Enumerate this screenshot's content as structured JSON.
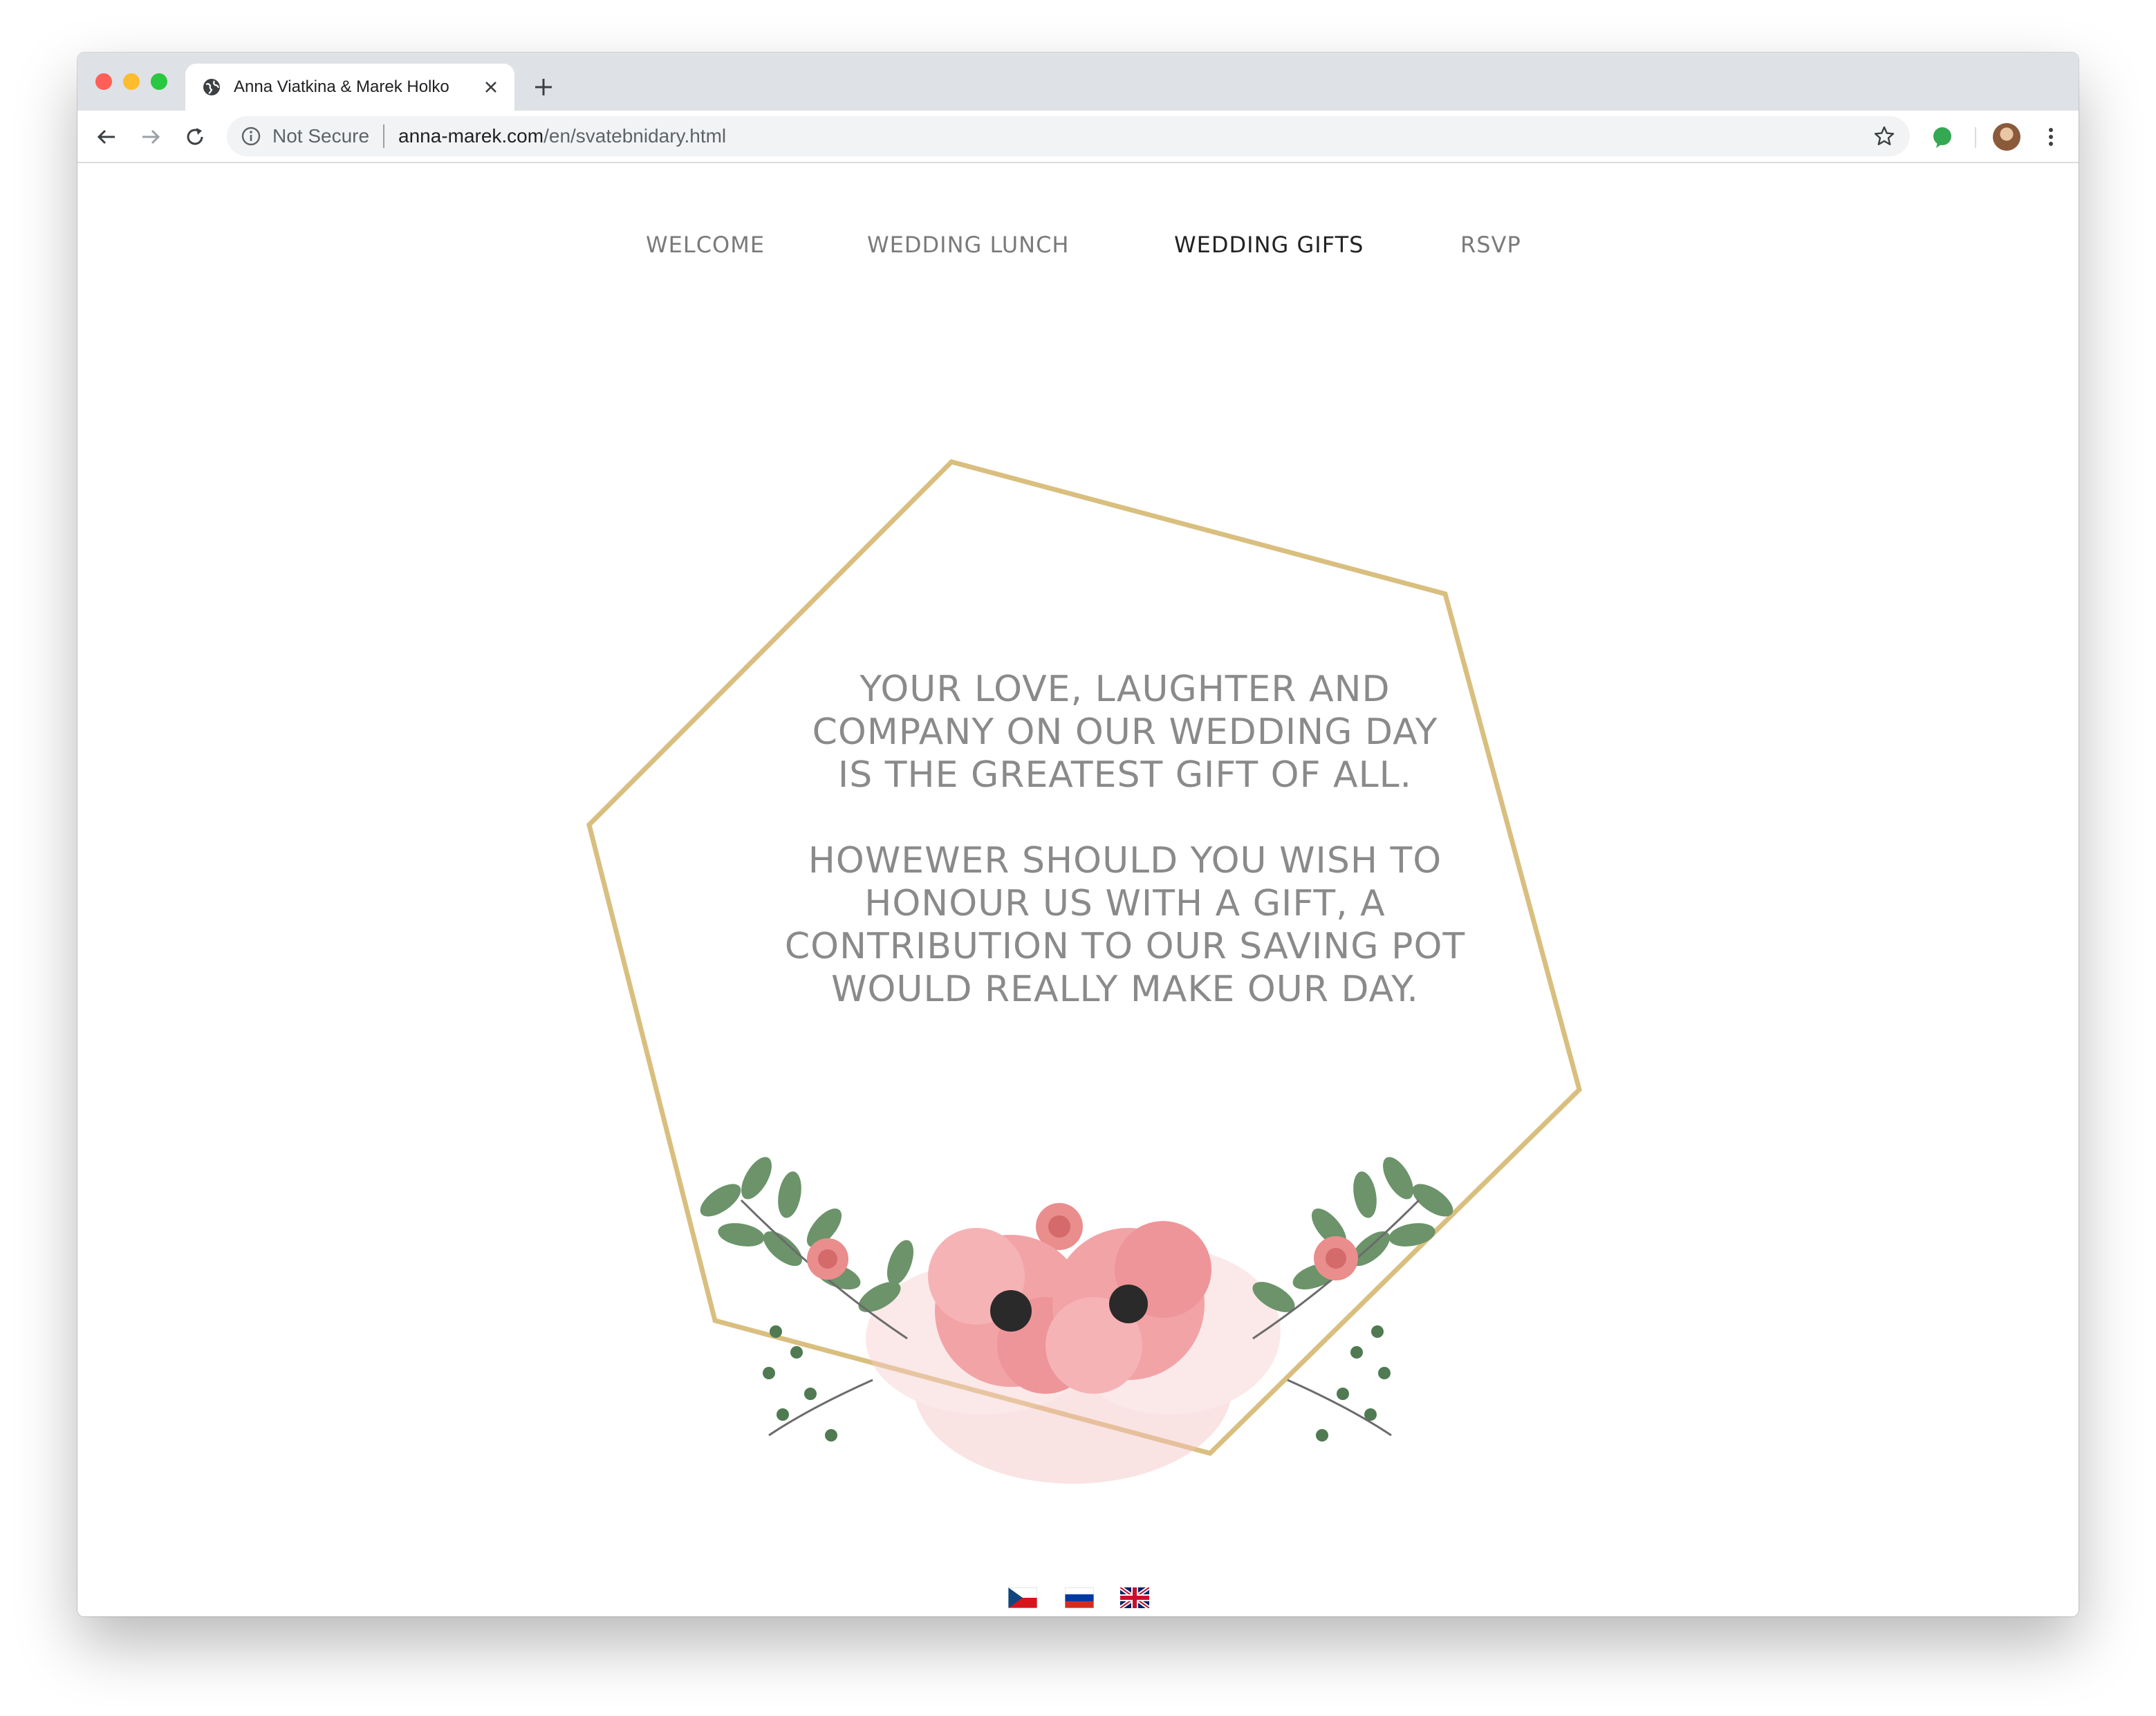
{
  "browser": {
    "tab_title": "Anna Viatkina & Marek Holko",
    "security_label": "Not Secure",
    "url_host": "anna-marek.com",
    "url_path": "/en/svatebnidary.html"
  },
  "nav": {
    "items": [
      {
        "label": "WELCOME",
        "active": false
      },
      {
        "label": "WEDDING LUNCH",
        "active": false
      },
      {
        "label": "WEDDING GIFTS",
        "active": true
      },
      {
        "label": "RSVP",
        "active": false
      }
    ]
  },
  "message": {
    "paragraph1": [
      "YOUR LOVE, LAUGHTER AND",
      "COMPANY ON OUR WEDDING DAY",
      "IS THE GREATEST GIFT OF ALL."
    ],
    "paragraph2": [
      "HOWEWER SHOULD YOU WISH TO",
      "HONOUR US WITH A GIFT, A",
      "CONTRIBUTION TO OUR SAVING POT",
      "WOULD REALLY MAKE OUR DAY."
    ]
  },
  "languages": [
    {
      "code": "cs",
      "icon": "czech-flag-icon"
    },
    {
      "code": "ru",
      "icon": "russian-flag-icon"
    },
    {
      "code": "en",
      "icon": "uk-flag-icon"
    }
  ],
  "colors": {
    "frame_gold": "#d9bf7f",
    "text_gray": "#8a8a8a",
    "nav_active": "#222222",
    "nav_inactive": "#7a7a7a",
    "flower_pink": "#f0a6a6",
    "leaf_green": "#5f8a5f"
  }
}
